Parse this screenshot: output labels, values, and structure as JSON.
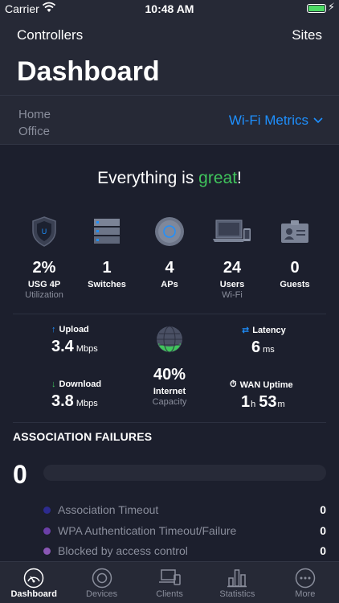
{
  "status_bar": {
    "carrier": "Carrier",
    "time": "10:48 AM",
    "battery_level": 1.0
  },
  "nav": {
    "left": "Controllers",
    "right": "Sites",
    "title": "Dashboard"
  },
  "site": {
    "line1": "Home",
    "line2": "Office",
    "metrics_selector": "Wi-Fi Metrics"
  },
  "headline": {
    "prefix": "Everything is ",
    "highlight": "great",
    "suffix": "!"
  },
  "devices": [
    {
      "icon": "usg-shield-icon",
      "value": "2%",
      "label": "USG 4P",
      "sub": "Utilization"
    },
    {
      "icon": "switch-stack-icon",
      "value": "1",
      "label": "Switches",
      "sub": ""
    },
    {
      "icon": "access-point-icon",
      "value": "4",
      "label": "APs",
      "sub": ""
    },
    {
      "icon": "laptop-phone-icon",
      "value": "24",
      "label": "Users",
      "sub": "Wi-Fi"
    },
    {
      "icon": "guest-badge-icon",
      "value": "0",
      "label": "Guests",
      "sub": ""
    }
  ],
  "network": {
    "upload": {
      "label": "Upload",
      "value": "3.4",
      "unit": "Mbps"
    },
    "download": {
      "label": "Download",
      "value": "3.8",
      "unit": "Mbps"
    },
    "latency": {
      "label": "Latency",
      "value": "6",
      "unit": "ms"
    },
    "wan": {
      "label": "WAN Uptime",
      "h": "1",
      "h_unit": "h",
      "m": "53",
      "m_unit": "m"
    },
    "internet": {
      "value": "40%",
      "label": "Internet",
      "sub": "Capacity"
    }
  },
  "association": {
    "title": "ASSOCIATION FAILURES",
    "total": "0",
    "items": [
      {
        "label": "Association Timeout",
        "value": "0",
        "color": "#2d2b8f"
      },
      {
        "label": "WPA Authentication Timeout/Failure",
        "value": "0",
        "color": "#6b3fa8"
      },
      {
        "label": "Blocked by access control",
        "value": "0",
        "color": "#8a57b5"
      }
    ]
  },
  "tabs": [
    {
      "label": "Dashboard",
      "icon": "dashboard-gauge-icon",
      "active": true
    },
    {
      "label": "Devices",
      "icon": "devices-circle-icon",
      "active": false
    },
    {
      "label": "Clients",
      "icon": "clients-devices-icon",
      "active": false
    },
    {
      "label": "Statistics",
      "icon": "statistics-bars-icon",
      "active": false
    },
    {
      "label": "More",
      "icon": "more-dots-icon",
      "active": false
    }
  ],
  "colors": {
    "accent": "#1e90ff",
    "good": "#40c45c",
    "background": "#1c1f2d",
    "header": "#262936"
  }
}
